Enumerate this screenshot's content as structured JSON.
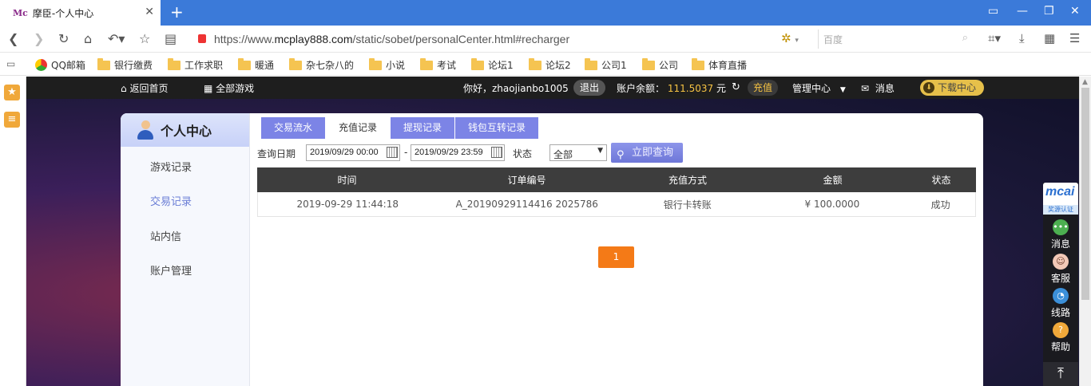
{
  "browser": {
    "tab_logo": "Mc",
    "tab_title": "摩臣-个人中心",
    "url_prefix": "https://www.",
    "url_domain": "mcplay888.com",
    "url_path": "/static/sobet/personalCenter.html#recharger",
    "search_placeholder": "百度",
    "bookmarks": [
      "QQ邮箱",
      "银行缴费",
      "工作求职",
      "暖通",
      "杂七杂八的",
      "小说",
      "考试",
      "论坛1",
      "论坛2",
      "公司1",
      "公司",
      "体育直播"
    ]
  },
  "site_nav": {
    "home": "返回首页",
    "all_games": "全部游戏",
    "greeting": "你好，zhaojianbo1005",
    "logout": "退出",
    "balance_label": "账户余额：",
    "balance_value": "111.5037",
    "balance_unit": "元",
    "recharge": "充值",
    "admin": "管理中心",
    "messages": "消息",
    "download": "下载中心"
  },
  "sidebar": {
    "title": "个人中心",
    "items": [
      "游戏记录",
      "交易记录",
      "站内信",
      "账户管理"
    ],
    "active": "交易记录"
  },
  "tabs": [
    "交易流水",
    "充值记录",
    "提现记录",
    "钱包互转记录"
  ],
  "selected_tab": "充值记录",
  "filters": {
    "date_label": "查询日期",
    "start_date": "2019/09/29 00:00",
    "separator": "-",
    "end_date": "2019/09/29 23:59",
    "status_label": "状态",
    "status_value": "全部",
    "query_button": "立即查询"
  },
  "table": {
    "headers": [
      "时间",
      "订单编号",
      "充值方式",
      "金额",
      "状态"
    ],
    "rows": [
      [
        "2019-09-29 11:44:18",
        "A_20190929114416 2025786",
        "银行卡转账",
        "¥ 100.0000",
        "成功"
      ]
    ]
  },
  "pagination": {
    "current": "1"
  },
  "right_toolbar": {
    "brand": "mcai",
    "brand_sub": "奖源认证",
    "items": [
      "消息",
      "客服",
      "线路",
      "帮助"
    ]
  }
}
